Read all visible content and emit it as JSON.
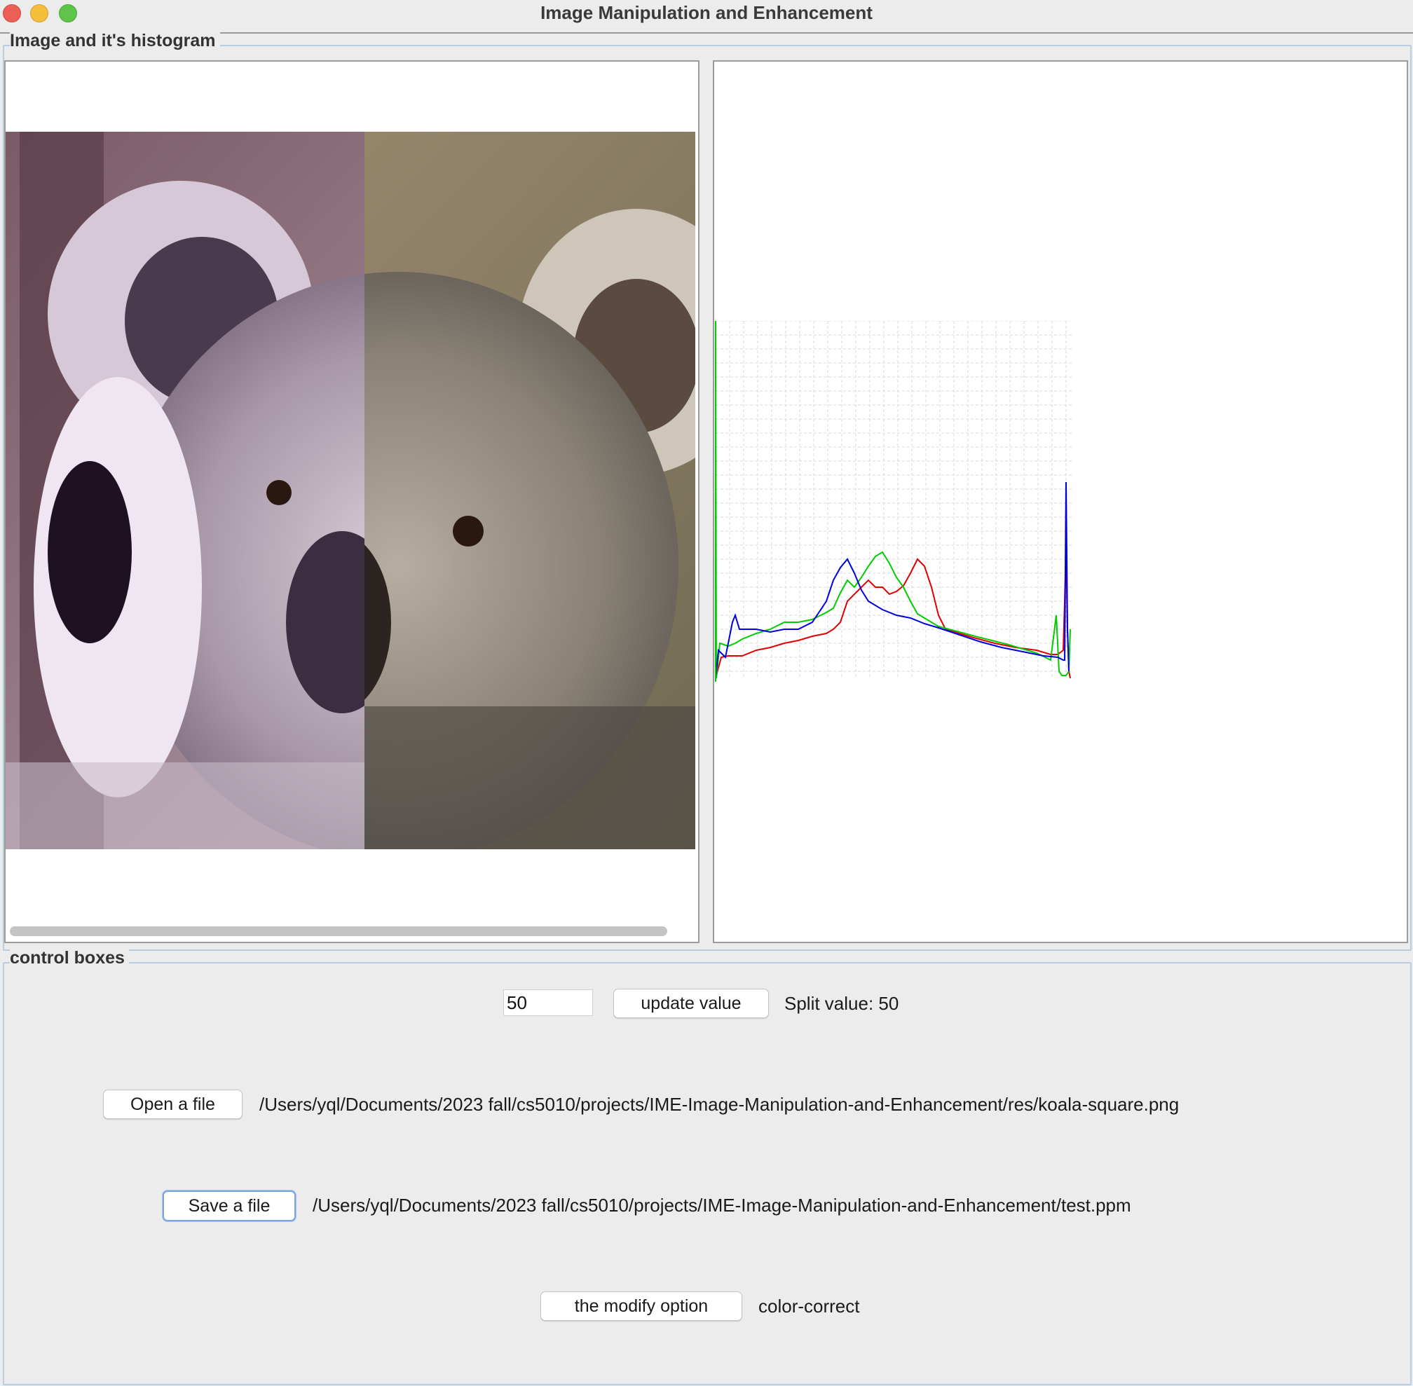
{
  "window": {
    "title": "Image Manipulation and Enhancement"
  },
  "image_group": {
    "legend": "Image and it's histogram"
  },
  "controls_group": {
    "legend": "control boxes",
    "split_input_value": "50",
    "update_button": "update value",
    "split_label": "Split value: 50",
    "open_button": "Open a file",
    "open_path": "/Users/yql/Documents/2023 fall/cs5010/projects/IME-Image-Manipulation-and-Enhancement/res/koala-square.png",
    "save_button": "Save a file",
    "save_path": "/Users/yql/Documents/2023 fall/cs5010/projects/IME-Image-Manipulation-and-Enhancement/test.ppm",
    "modify_button": "the modify option",
    "modify_value": "color-correct"
  },
  "colors": {
    "red_channel": "#e00000",
    "green_channel": "#00cc00",
    "blue_channel": "#0000dd",
    "grid": "#d8d8d8"
  }
}
